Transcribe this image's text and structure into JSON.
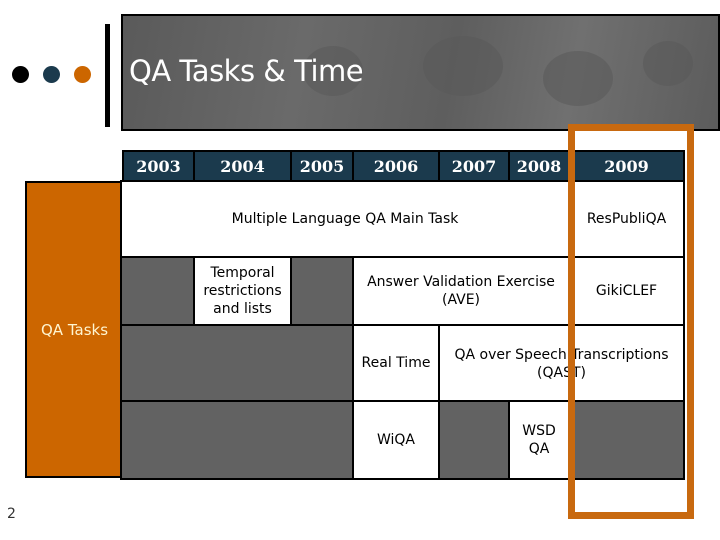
{
  "slide": {
    "title": "QA Tasks & Time",
    "page_number": "2",
    "bullet_colors": [
      "#000000",
      "#1b3a4d",
      "#cc6600"
    ],
    "highlight_color": "#c8690f",
    "accent_color": "#cc6600",
    "header_color": "#1b3a4d"
  },
  "timeline": {
    "side_label": "QA Tasks",
    "years": [
      "2003",
      "2004",
      "2005",
      "2006",
      "2007",
      "2008",
      "2009"
    ],
    "highlighted_year": "2009",
    "tasks": {
      "main_task": "Multiple Language QA Main Task",
      "respubliqa": "ResPubliQA",
      "temporal": "Temporal restrictions and lists",
      "ave": "Answer Validation Exercise (AVE)",
      "gikiclef": "GikiCLEF",
      "real_time": "Real Time",
      "qast": "QA over Speech Transcriptions (QAST)",
      "wiqa": "WiQA",
      "wsd_qa": "WSD QA"
    }
  }
}
